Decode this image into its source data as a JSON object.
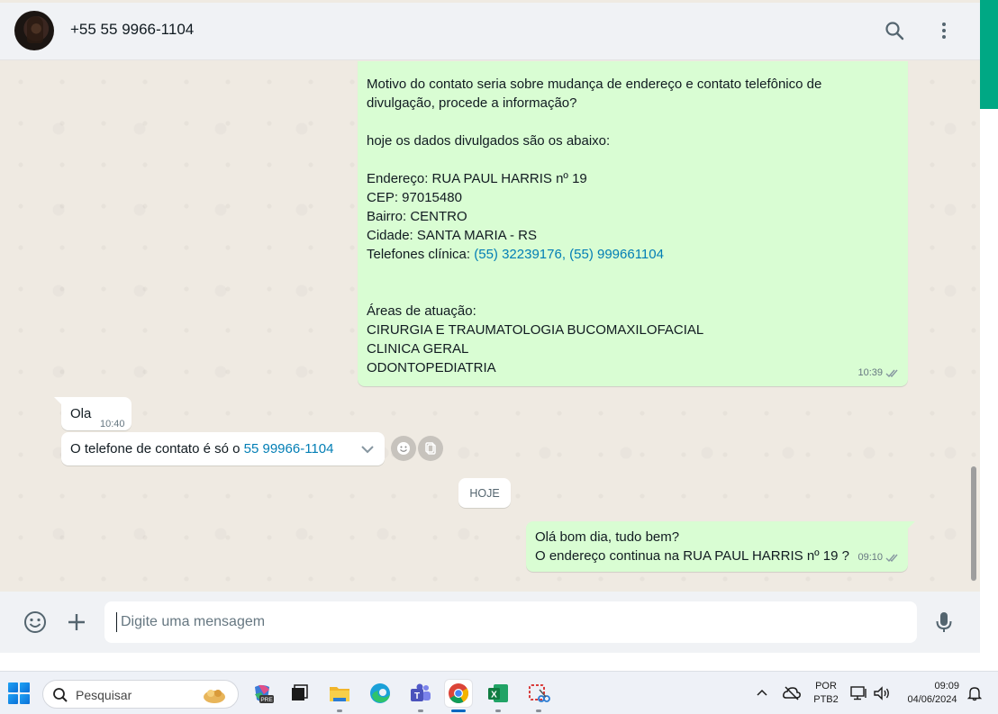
{
  "header": {
    "contact_name": "+55 55 9966-1104",
    "icons": [
      "search-icon",
      "menu-kebab-icon"
    ]
  },
  "messages": {
    "long": {
      "lines": [
        "Motivo do contato seria sobre mudança de endereço e contato telefônico de",
        "divulgação, procede a informação?",
        "",
        "hoje os dados divulgados são os abaixo:",
        "",
        "Endereço: RUA PAUL HARRIS nº 19",
        "CEP: 97015480",
        "Bairro: CENTRO",
        "Cidade: SANTA MARIA - RS",
        "",
        "",
        "",
        "Áreas de atuação:",
        "CIRURGIA E TRAUMATOLOGIA BUCOMAXILOFACIAL",
        "CLINICA GERAL",
        "ODONTOPEDIATRIA"
      ],
      "phones_label": "Telefones clínica: ",
      "phones_link": "(55) 32239176, (55) 999661104",
      "time": "10:39"
    },
    "ola": {
      "text": "Ola",
      "time": "10:40"
    },
    "phone": {
      "text": "O telefone de contato é só o ",
      "link": "55 99966-1104"
    },
    "date_chip": "HOJE",
    "hello": {
      "line1": "Olá bom dia, tudo bem?",
      "line2": "O endereço continua na RUA PAUL HARRIS nº 19 ?",
      "time": "09:10"
    }
  },
  "composer": {
    "placeholder": "Digite uma mensagem"
  },
  "taskbar": {
    "search_label": "Pesquisar",
    "language_top": "POR",
    "language_bottom": "PTB2",
    "time": "09:09",
    "date": "04/06/2024",
    "copilot_badge": "PRE"
  },
  "colors": {
    "accent": "#00a884",
    "outgoing_bubble": "#d9fdd3",
    "link": "#027eb5",
    "chat_background": "#efeae2"
  }
}
